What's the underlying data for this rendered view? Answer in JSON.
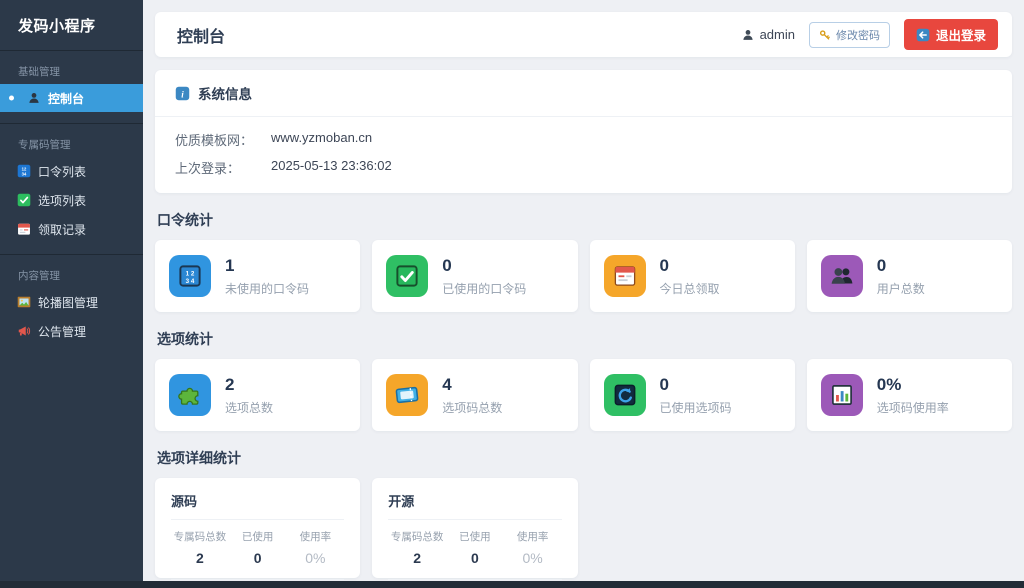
{
  "sidebar": {
    "title": "发码小程序",
    "sections": [
      {
        "label": "基础管理",
        "items": [
          {
            "label": "控制台",
            "icon": "user-icon",
            "active": true
          }
        ]
      },
      {
        "label": "专属码管理",
        "items": [
          {
            "label": "口令列表",
            "icon": "numbers-icon"
          },
          {
            "label": "选项列表",
            "icon": "check-icon"
          },
          {
            "label": "领取记录",
            "icon": "calendar-icon"
          }
        ]
      },
      {
        "label": "内容管理",
        "items": [
          {
            "label": "轮播图管理",
            "icon": "picture-frame-icon"
          },
          {
            "label": "公告管理",
            "icon": "megaphone-icon"
          }
        ]
      }
    ]
  },
  "header": {
    "title": "控制台",
    "username": "admin",
    "change_password_label": "修改密码",
    "logout_label": "退出登录"
  },
  "system_info": {
    "title": "系统信息",
    "icon": "info-icon",
    "rows": [
      {
        "label": "优质模板网：",
        "value": "www.yzmoban.cn"
      },
      {
        "label": "上次登录：",
        "value": "2025-05-13 23:36:02"
      }
    ]
  },
  "password_stats": {
    "title": "口令统计",
    "cards": [
      {
        "value": "1",
        "label": "未使用的口令码",
        "icon": "numbers-icon",
        "color": "#3095e0"
      },
      {
        "value": "0",
        "label": "已使用的口令码",
        "icon": "check-icon",
        "color": "#2fbf64"
      },
      {
        "value": "0",
        "label": "今日总领取",
        "icon": "calendar-icon",
        "color": "#f5a62a"
      },
      {
        "value": "0",
        "label": "用户总数",
        "icon": "users-icon",
        "color": "#9c59b8"
      }
    ]
  },
  "option_stats": {
    "title": "选项统计",
    "cards": [
      {
        "value": "2",
        "label": "选项总数",
        "icon": "puzzle-icon",
        "color": "#3095e0"
      },
      {
        "value": "4",
        "label": "选项码总数",
        "icon": "ticket-icon",
        "color": "#f5a62a"
      },
      {
        "value": "0",
        "label": "已使用选项码",
        "icon": "refresh-icon",
        "color": "#2fbf64"
      },
      {
        "value": "0%",
        "label": "选项码使用率",
        "icon": "chart-icon",
        "color": "#9c59b8"
      }
    ]
  },
  "detail_stats": {
    "title": "选项详细统计",
    "cards": [
      {
        "title": "源码",
        "columns": [
          "专属码总数",
          "已使用",
          "使用率"
        ],
        "values": [
          "2",
          "0",
          "0%"
        ]
      },
      {
        "title": "开源",
        "columns": [
          "专属码总数",
          "已使用",
          "使用率"
        ],
        "values": [
          "2",
          "0",
          "0%"
        ]
      }
    ]
  },
  "colors": {
    "sidebar_bg": "#2c3949",
    "active_item_blue": "#3a9cdb",
    "logout_red": "#e8473e",
    "main_bg": "#eef0f4"
  }
}
